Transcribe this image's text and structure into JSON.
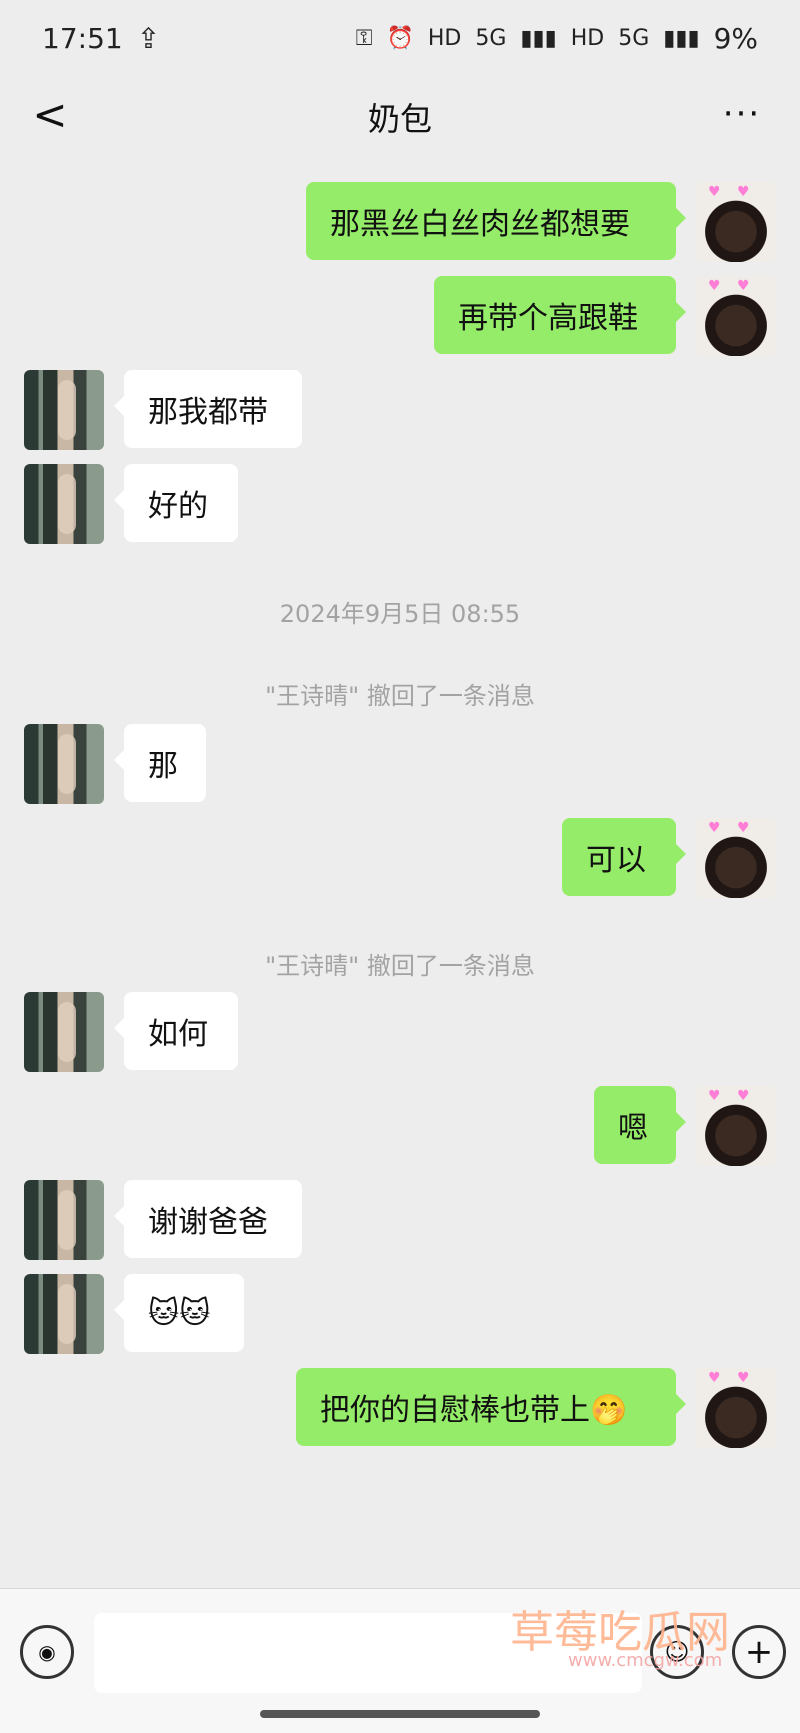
{
  "status": {
    "time": "17:51",
    "icons": [
      "upload-icon",
      "key-icon",
      "alarm-icon",
      "hd-icon",
      "5g-icon",
      "signal-icon",
      "hd-icon",
      "5g-signal-icon"
    ],
    "hd1": "HD",
    "net1": "5G",
    "hd2": "HD",
    "net2": "5G",
    "battery": "9%"
  },
  "header": {
    "title": "奶包",
    "back_label": "<",
    "more_label": "···"
  },
  "chat": {
    "messages": [
      {
        "side": "right",
        "text": "那黑丝白丝肉丝都想要"
      },
      {
        "side": "right",
        "text": "再带个高跟鞋"
      },
      {
        "side": "left",
        "text": "那我都带"
      },
      {
        "side": "left",
        "text": "好的"
      },
      {
        "side": "left",
        "text": "那"
      },
      {
        "side": "right",
        "text": "可以"
      },
      {
        "side": "left",
        "text": "如何"
      },
      {
        "side": "right",
        "text": "嗯"
      },
      {
        "side": "left",
        "text": "谢谢爸爸"
      },
      {
        "side": "left",
        "text": "🐱🐱"
      },
      {
        "side": "right",
        "text": "把你的自慰棒也带上🤭"
      }
    ],
    "system_time": "2024年9月5日 08:55",
    "recall1": "\"王诗晴\" 撤回了一条消息",
    "recall2": "\"王诗晴\" 撤回了一条消息"
  },
  "input": {
    "placeholder": "",
    "voice_icon": "voice-icon",
    "emoji_icon": "emoji-icon",
    "plus_icon": "plus-icon"
  },
  "watermark": {
    "main": "草莓吃瓜网",
    "sub": "www.cmcgw.com"
  }
}
